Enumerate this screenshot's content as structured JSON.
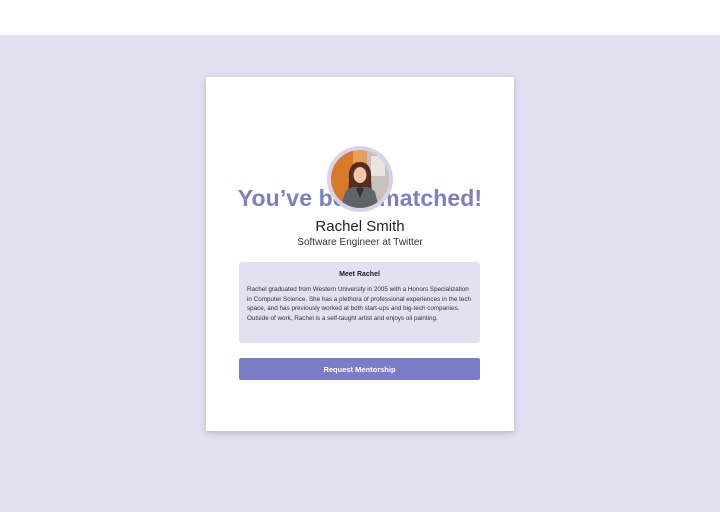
{
  "match": {
    "headline": "You’ve been matched!",
    "mentor": {
      "name": "Rachel Smith",
      "role": "Software Engineer at Twitter",
      "avatar_icon": "profile-photo"
    },
    "bio": {
      "title": "Meet Rachel",
      "text": "Rachel graduated from Western University in 2005 with a Honors Specialization in Computer Science. She has a plethora of professional experiences in the tech space, and has previously worked at both start-ups and big-tech companies. Outside of work, Rachel is a self-taught artist and enjoys oil painting."
    },
    "cta_label": "Request Mentorship"
  },
  "colors": {
    "background": "#e3e0f2",
    "accent": "#7a7cc8",
    "headline": "#7b7fc6",
    "bio_box": "#e2e0f1"
  }
}
